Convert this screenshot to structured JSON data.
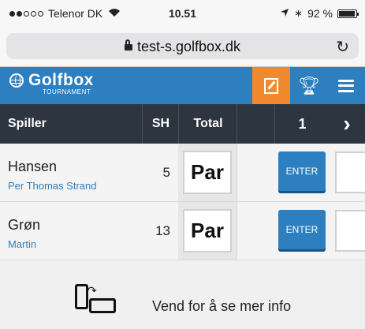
{
  "status_bar": {
    "carrier": "Telenor DK",
    "time": "10.51",
    "battery": "92 %"
  },
  "browser": {
    "url": "test-s.golfbox.dk",
    "reload_glyph": "↻"
  },
  "app_bar": {
    "logo_text": "Golfbox",
    "logo_sub": "TOURNAMENT",
    "icons": [
      "scorecard-icon",
      "trophy-icon",
      "menu-icon"
    ],
    "active_color": "#f08a2c",
    "brand_color": "#2d7fc0"
  },
  "table": {
    "headers": {
      "player": "Spiller",
      "sh": "SH",
      "total": "Total",
      "hole": "1",
      "next": "›"
    },
    "rows": [
      {
        "name": "Hansen",
        "sub": "Per Thomas Strand",
        "sh": "5",
        "total": "Par",
        "action": "ENTER"
      },
      {
        "name": "Grøn",
        "sub": "Martin",
        "sh": "13",
        "total": "Par",
        "action": "ENTER"
      }
    ]
  },
  "hint": {
    "text": "Vend for å se mer info",
    "icon": "rotate-phone-icon"
  }
}
